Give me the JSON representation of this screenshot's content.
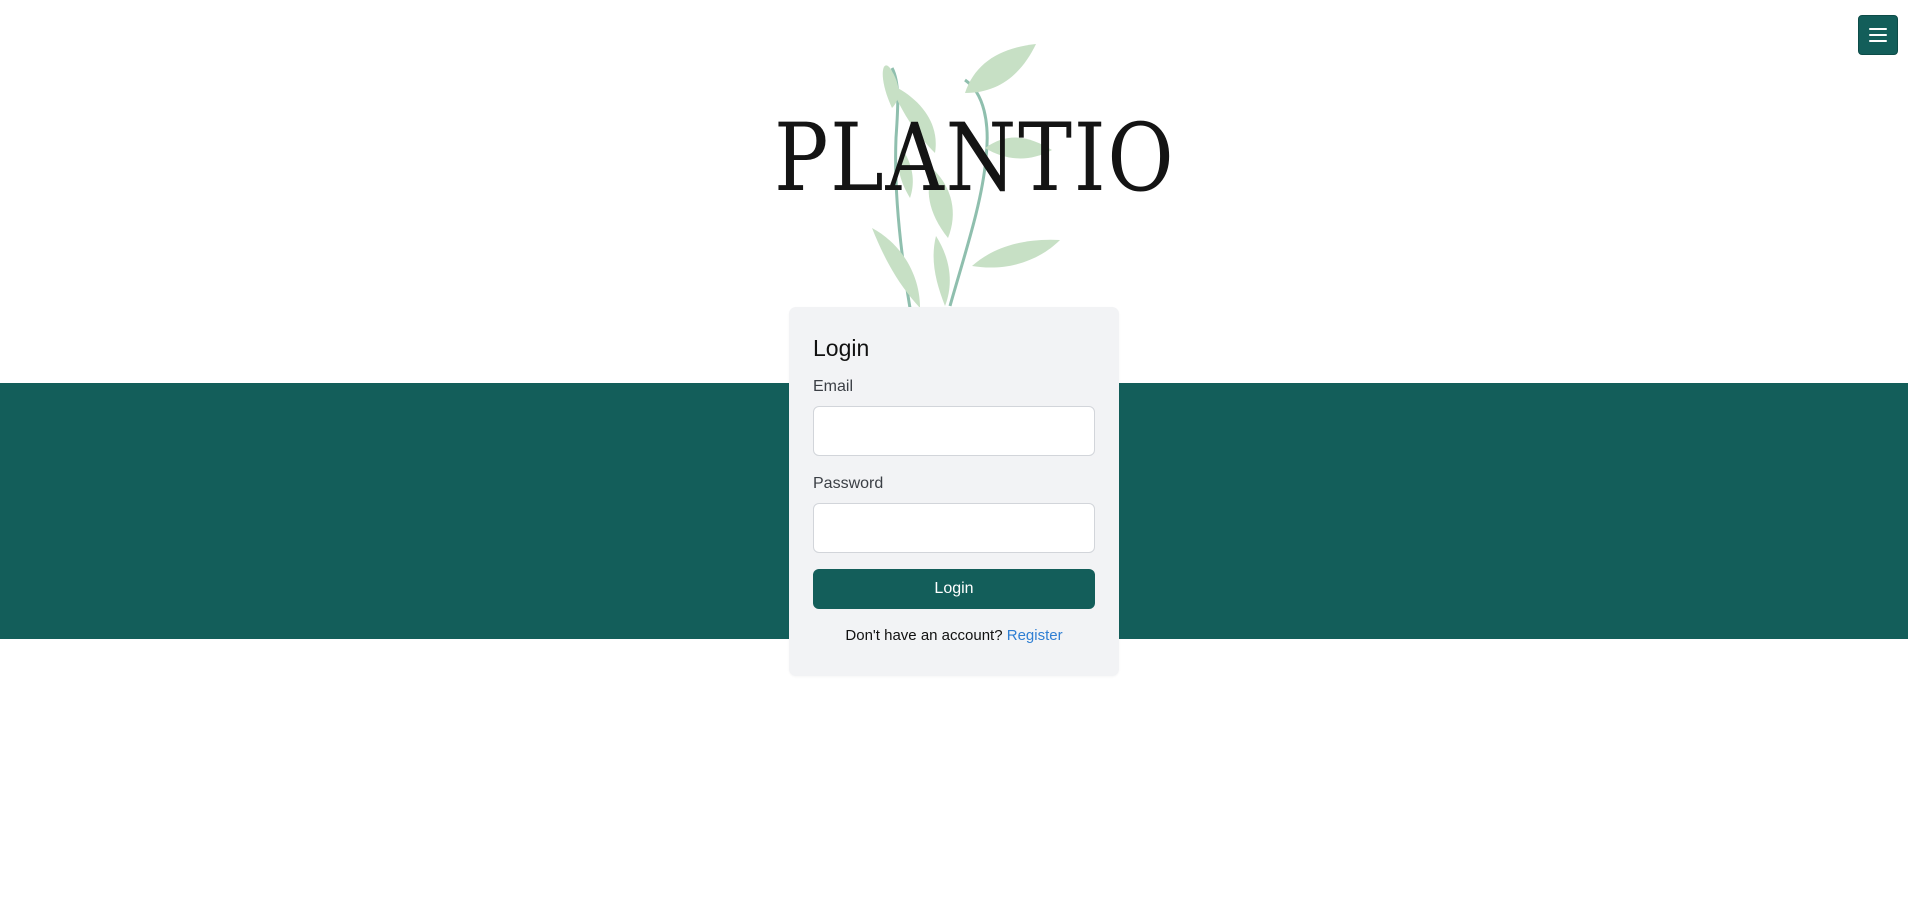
{
  "header": {
    "menu_icon": "hamburger-menu-icon",
    "brand_color": "#135e5a"
  },
  "logo": {
    "text": "PLANTIO",
    "decoration": "leaf-branch-icon"
  },
  "login_form": {
    "title": "Login",
    "email_label": "Email",
    "email_value": "",
    "email_placeholder": "",
    "password_label": "Password",
    "password_value": "",
    "password_placeholder": "",
    "submit_label": "Login",
    "register_prompt": "Don't have an account?",
    "register_link": "Register"
  },
  "colors": {
    "band": "#135e5a",
    "card": "#f2f3f5",
    "link": "#2f7fd3",
    "leaf": "#c7e0c5"
  }
}
